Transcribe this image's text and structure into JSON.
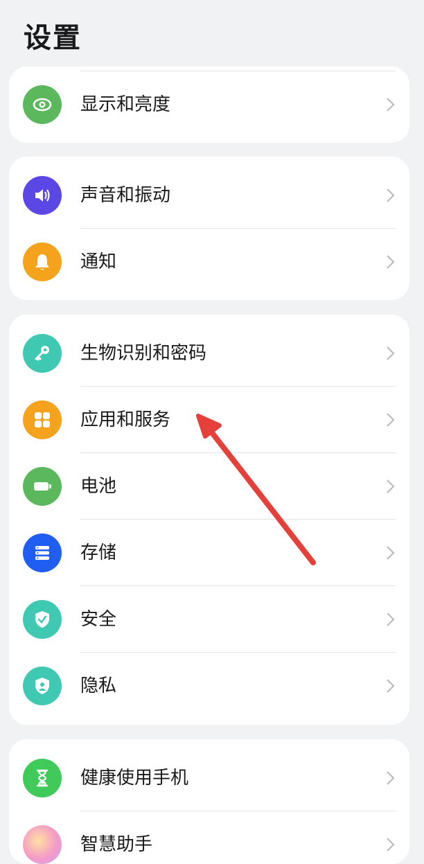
{
  "header": {
    "title": "设置"
  },
  "groups": [
    {
      "items": [
        {
          "label": "显示和亮度",
          "icon": "eye-icon",
          "color": "#5bb85d"
        }
      ]
    },
    {
      "items": [
        {
          "label": "声音和振动",
          "icon": "speaker-icon",
          "color": "#5b47e6"
        },
        {
          "label": "通知",
          "icon": "bell-icon",
          "color": "#f5a31c"
        }
      ]
    },
    {
      "items": [
        {
          "label": "生物识别和密码",
          "icon": "key-icon",
          "color": "#3fc9b3"
        },
        {
          "label": "应用和服务",
          "icon": "apps-grid-icon",
          "color": "#f5a31c"
        },
        {
          "label": "电池",
          "icon": "battery-icon",
          "color": "#5bb85d"
        },
        {
          "label": "存储",
          "icon": "storage-icon",
          "color": "#1f5ef0"
        },
        {
          "label": "安全",
          "icon": "shield-check-icon",
          "color": "#3fc9b3"
        },
        {
          "label": "隐私",
          "icon": "privacy-shield-icon",
          "color": "#3fc9b3"
        }
      ]
    },
    {
      "items": [
        {
          "label": "健康使用手机",
          "icon": "hourglass-icon",
          "color": "#3fca5a"
        },
        {
          "label": "智慧助手",
          "icon": "assistant-orb-icon",
          "color": "#f0a0c8"
        }
      ]
    }
  ],
  "annotation": {
    "type": "red-arrow",
    "color": "#e5403a",
    "points_to": "应用和服务"
  }
}
